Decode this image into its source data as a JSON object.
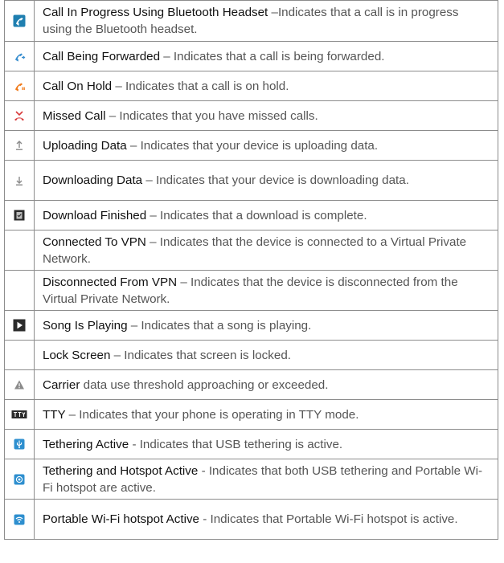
{
  "rows": [
    {
      "icon": "bluetooth-call-icon",
      "term": "Call In Progress Using Bluetooth Headset",
      "desc": " –Indicates that a call is in progress using the Bluetooth headset."
    },
    {
      "icon": "call-forwarded-icon",
      "term": "Call Being Forwarded",
      "desc": " – Indicates that a call is being forwarded."
    },
    {
      "icon": "call-on-hold-icon",
      "term": "Call On Hold",
      "desc": " – Indicates that a call is on hold."
    },
    {
      "icon": "missed-call-icon",
      "term": "Missed Call",
      "desc": " – Indicates that you have missed calls."
    },
    {
      "icon": "upload-icon",
      "term": "Uploading Data",
      "desc": " – Indicates that your device is uploading data."
    },
    {
      "icon": "download-icon",
      "term": "Downloading Data",
      "desc": " – Indicates that your device is downloading data."
    },
    {
      "icon": "download-finished-icon",
      "term": "Download Finished",
      "desc": " – Indicates that a download is complete."
    },
    {
      "icon": "",
      "term": "Connected To VPN",
      "desc": " – Indicates that the device is connected to a Virtual Private Network."
    },
    {
      "icon": "",
      "term": "Disconnected From VPN",
      "desc": " – Indicates that the device is disconnected from the Virtual Private Network."
    },
    {
      "icon": "play-icon",
      "term": "Song Is Playing",
      "desc": " – Indicates that a song is playing."
    },
    {
      "icon": "",
      "term": "Lock Screen",
      "desc": " – Indicates that screen is locked."
    },
    {
      "icon": "warning-icon",
      "term": "Carrier",
      "desc": " data use threshold approaching or exceeded."
    },
    {
      "icon": "tty-icon",
      "term": "TTY",
      "desc": " – Indicates that your phone is operating in TTY mode."
    },
    {
      "icon": "usb-tethering-icon",
      "term": "Tethering Active",
      "desc": " - Indicates that USB tethering is active."
    },
    {
      "icon": "tethering-hotspot-icon",
      "term": "Tethering and Hotspot Active",
      "desc": " - Indicates that both USB tethering and Portable Wi-Fi hotspot are active."
    },
    {
      "icon": "wifi-hotspot-icon",
      "term": "Portable Wi-Fi hotspot Active",
      "desc": " - Indicates that Portable Wi-Fi hotspot is active."
    }
  ],
  "icon_colors": {
    "bluetooth": "#1f7fb0",
    "forward": "#3a8fcf",
    "hold": "#f07a1a",
    "missed": "#d8393a",
    "dark": "#2b2b2b",
    "gray": "#8a8a8a",
    "tether": "#2e8fcf"
  }
}
